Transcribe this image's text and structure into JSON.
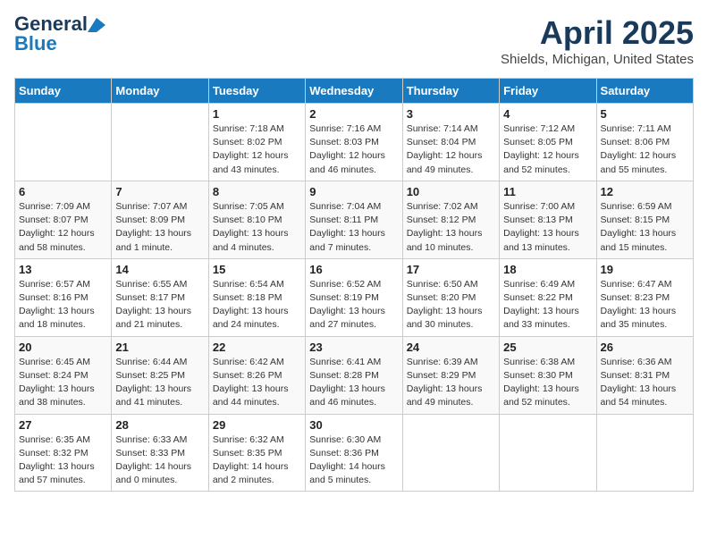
{
  "logo": {
    "line1": "General",
    "line2": "Blue"
  },
  "title": "April 2025",
  "subtitle": "Shields, Michigan, United States",
  "days_of_week": [
    "Sunday",
    "Monday",
    "Tuesday",
    "Wednesday",
    "Thursday",
    "Friday",
    "Saturday"
  ],
  "weeks": [
    [
      {
        "day": "",
        "detail": ""
      },
      {
        "day": "",
        "detail": ""
      },
      {
        "day": "1",
        "detail": "Sunrise: 7:18 AM\nSunset: 8:02 PM\nDaylight: 12 hours and 43 minutes."
      },
      {
        "day": "2",
        "detail": "Sunrise: 7:16 AM\nSunset: 8:03 PM\nDaylight: 12 hours and 46 minutes."
      },
      {
        "day": "3",
        "detail": "Sunrise: 7:14 AM\nSunset: 8:04 PM\nDaylight: 12 hours and 49 minutes."
      },
      {
        "day": "4",
        "detail": "Sunrise: 7:12 AM\nSunset: 8:05 PM\nDaylight: 12 hours and 52 minutes."
      },
      {
        "day": "5",
        "detail": "Sunrise: 7:11 AM\nSunset: 8:06 PM\nDaylight: 12 hours and 55 minutes."
      }
    ],
    [
      {
        "day": "6",
        "detail": "Sunrise: 7:09 AM\nSunset: 8:07 PM\nDaylight: 12 hours and 58 minutes."
      },
      {
        "day": "7",
        "detail": "Sunrise: 7:07 AM\nSunset: 8:09 PM\nDaylight: 13 hours and 1 minute."
      },
      {
        "day": "8",
        "detail": "Sunrise: 7:05 AM\nSunset: 8:10 PM\nDaylight: 13 hours and 4 minutes."
      },
      {
        "day": "9",
        "detail": "Sunrise: 7:04 AM\nSunset: 8:11 PM\nDaylight: 13 hours and 7 minutes."
      },
      {
        "day": "10",
        "detail": "Sunrise: 7:02 AM\nSunset: 8:12 PM\nDaylight: 13 hours and 10 minutes."
      },
      {
        "day": "11",
        "detail": "Sunrise: 7:00 AM\nSunset: 8:13 PM\nDaylight: 13 hours and 13 minutes."
      },
      {
        "day": "12",
        "detail": "Sunrise: 6:59 AM\nSunset: 8:15 PM\nDaylight: 13 hours and 15 minutes."
      }
    ],
    [
      {
        "day": "13",
        "detail": "Sunrise: 6:57 AM\nSunset: 8:16 PM\nDaylight: 13 hours and 18 minutes."
      },
      {
        "day": "14",
        "detail": "Sunrise: 6:55 AM\nSunset: 8:17 PM\nDaylight: 13 hours and 21 minutes."
      },
      {
        "day": "15",
        "detail": "Sunrise: 6:54 AM\nSunset: 8:18 PM\nDaylight: 13 hours and 24 minutes."
      },
      {
        "day": "16",
        "detail": "Sunrise: 6:52 AM\nSunset: 8:19 PM\nDaylight: 13 hours and 27 minutes."
      },
      {
        "day": "17",
        "detail": "Sunrise: 6:50 AM\nSunset: 8:20 PM\nDaylight: 13 hours and 30 minutes."
      },
      {
        "day": "18",
        "detail": "Sunrise: 6:49 AM\nSunset: 8:22 PM\nDaylight: 13 hours and 33 minutes."
      },
      {
        "day": "19",
        "detail": "Sunrise: 6:47 AM\nSunset: 8:23 PM\nDaylight: 13 hours and 35 minutes."
      }
    ],
    [
      {
        "day": "20",
        "detail": "Sunrise: 6:45 AM\nSunset: 8:24 PM\nDaylight: 13 hours and 38 minutes."
      },
      {
        "day": "21",
        "detail": "Sunrise: 6:44 AM\nSunset: 8:25 PM\nDaylight: 13 hours and 41 minutes."
      },
      {
        "day": "22",
        "detail": "Sunrise: 6:42 AM\nSunset: 8:26 PM\nDaylight: 13 hours and 44 minutes."
      },
      {
        "day": "23",
        "detail": "Sunrise: 6:41 AM\nSunset: 8:28 PM\nDaylight: 13 hours and 46 minutes."
      },
      {
        "day": "24",
        "detail": "Sunrise: 6:39 AM\nSunset: 8:29 PM\nDaylight: 13 hours and 49 minutes."
      },
      {
        "day": "25",
        "detail": "Sunrise: 6:38 AM\nSunset: 8:30 PM\nDaylight: 13 hours and 52 minutes."
      },
      {
        "day": "26",
        "detail": "Sunrise: 6:36 AM\nSunset: 8:31 PM\nDaylight: 13 hours and 54 minutes."
      }
    ],
    [
      {
        "day": "27",
        "detail": "Sunrise: 6:35 AM\nSunset: 8:32 PM\nDaylight: 13 hours and 57 minutes."
      },
      {
        "day": "28",
        "detail": "Sunrise: 6:33 AM\nSunset: 8:33 PM\nDaylight: 14 hours and 0 minutes."
      },
      {
        "day": "29",
        "detail": "Sunrise: 6:32 AM\nSunset: 8:35 PM\nDaylight: 14 hours and 2 minutes."
      },
      {
        "day": "30",
        "detail": "Sunrise: 6:30 AM\nSunset: 8:36 PM\nDaylight: 14 hours and 5 minutes."
      },
      {
        "day": "",
        "detail": ""
      },
      {
        "day": "",
        "detail": ""
      },
      {
        "day": "",
        "detail": ""
      }
    ]
  ]
}
